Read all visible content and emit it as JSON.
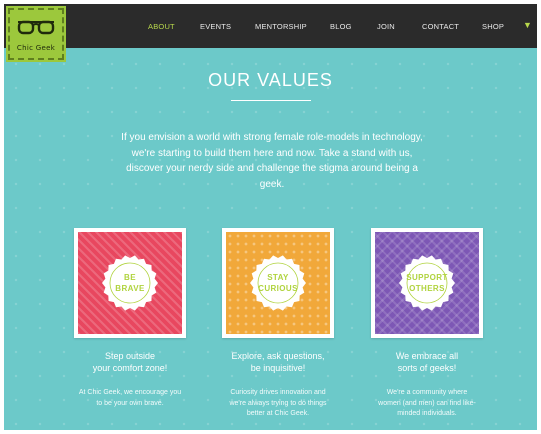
{
  "brand": {
    "logo_text": "Chic Geek"
  },
  "nav": {
    "items": [
      {
        "label": "ABOUT",
        "active": true
      },
      {
        "label": "EVENTS",
        "active": false
      },
      {
        "label": "MENTORSHIP",
        "active": false
      },
      {
        "label": "BLOG",
        "active": false
      },
      {
        "label": "JOIN",
        "active": false
      },
      {
        "label": "CONTACT",
        "active": false
      },
      {
        "label": "SHOP",
        "active": false
      }
    ],
    "overflow_icon": "chevron-down-icon"
  },
  "hero": {
    "title": "OUR VALUES",
    "intro": "If you envision a world with strong female role-models in technology, we're starting to build them here and now. Take a stand with us, discover your nerdy side and challenge the stigma around being a geek."
  },
  "values": [
    {
      "badge": "BE\nBRAVE",
      "heading": "Step outside\nyour comfort zone!",
      "body": "At Chic Geek, we encourage you\nto be your own brave.",
      "color": "#e8475f"
    },
    {
      "badge": "STAY\nCURIOUS",
      "heading": "Explore, ask questions,\nbe inquisitive!",
      "body": "Curiosity drives innovation and\nwe're always trying to do things\nbetter at Chic Geek.",
      "color": "#f1a83a"
    },
    {
      "badge": "SUPPORT\nOTHERS",
      "heading": "We embrace all\nsorts of geeks!",
      "body": "We're a community where\nwomen (and men) can find like-\nminded individuals.",
      "color": "#7d57b5"
    }
  ],
  "colors": {
    "background": "#6cc9c9",
    "nav_bg": "#2b2b2b",
    "accent_green": "#b0d33e"
  }
}
